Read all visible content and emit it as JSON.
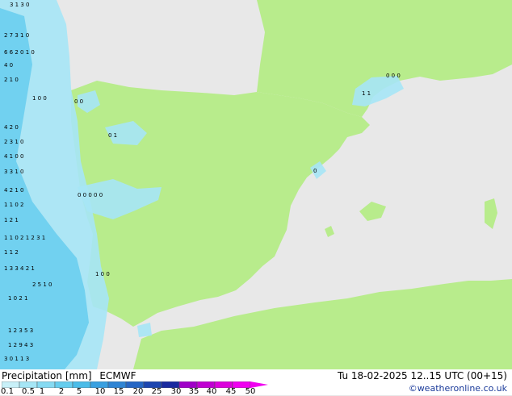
{
  "legend": {
    "title": "Precipitation [mm]",
    "model": "ECMWF",
    "datetime": "Tu 18-02-2025 12..15 UTC (00+15)",
    "credit": "©weatheronline.co.uk",
    "scale_labels": [
      "0.1",
      "0.5",
      "1",
      "2",
      "5",
      "10",
      "15",
      "20",
      "25",
      "30",
      "35",
      "40",
      "45",
      "50"
    ],
    "scale_colors": [
      "#c8f0f8",
      "#a6e6f6",
      "#86daf2",
      "#66cdee",
      "#4bbce8",
      "#3aa0e0",
      "#2f84d4",
      "#2666c4",
      "#1d46b0",
      "#1a2aa0",
      "#a000c8",
      "#c000d2",
      "#dc00dc",
      "#f000f0"
    ]
  },
  "colors": {
    "land": "#b8ec8c",
    "sea": "#e8e8e8",
    "light_precip": "#a6e6f6",
    "heavy_precip": "#66cdee"
  },
  "values": {
    "rows": [
      "3 1 3 0",
      "2 7 3 1 0",
      "6 6 2 0 1 0",
      "4 0",
      "2 1 0",
      "1 0 0",
      "4 2 0",
      "2 3 1 0",
      "4 1 0 0",
      "3 3 1 0",
      "4 2 1 0",
      "1 1 0 2",
      "1 2 1",
      "1 1 0 2 1 2 3 1",
      "1 1 2",
      "1 3 3 4 2 1",
      "2 5 1 0",
      "1 0 2 1",
      "1 2 3 5 3",
      "1 2 9 4 3",
      "3 0 1 1 3"
    ],
    "galicia": "0 0",
    "north": "0 1",
    "central": "0 0 0 0 0",
    "portugal": "1 0 0",
    "pyrenees": "0 0 0",
    "pyrenees_west": "1 1",
    "valencia": "0"
  }
}
